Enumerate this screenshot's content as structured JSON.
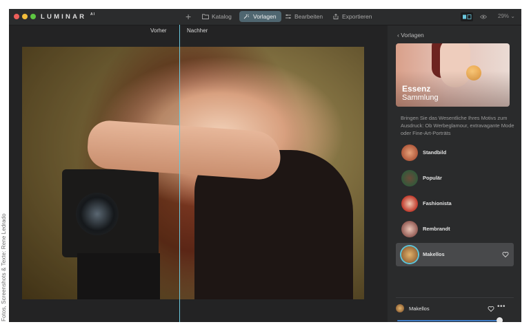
{
  "credit": "Fotos, Screenshots & Texte: Rene Ledrado",
  "app": {
    "logo": "LUMINAR",
    "logo_suffix": "AI",
    "toolbar": {
      "plus": "+",
      "tabs": [
        {
          "label": "Katalog",
          "icon": "folder-icon"
        },
        {
          "label": "Vorlagen",
          "icon": "presets-icon",
          "active": true
        },
        {
          "label": "Bearbeiten",
          "icon": "sliders-icon"
        },
        {
          "label": "Exportieren",
          "icon": "export-icon"
        }
      ],
      "zoom": "29% ⌄"
    },
    "compare": {
      "before": "Vorher",
      "after": "Nachher"
    }
  },
  "panel": {
    "back_label": "Vorlagen",
    "hero": {
      "title": "Essenz",
      "subtitle": "Sammlung"
    },
    "description": "Bringen Sie das Wesentliche Ihres Motivs zum Ausdruck: Ob Werbeglamour, extravagante Mode oder Fine-Art-Porträts",
    "presets": [
      {
        "name": "Standbild"
      },
      {
        "name": "Populär"
      },
      {
        "name": "Fashionista"
      },
      {
        "name": "Rembrandt"
      },
      {
        "name": "Makellos",
        "active": true
      }
    ],
    "applied": {
      "name": "Makellos",
      "more": "•••",
      "amount": 0.97
    }
  },
  "colors": {
    "accent": "#6ac8de",
    "active_tab": "#4f6670",
    "slider": "#3d7bc4"
  }
}
